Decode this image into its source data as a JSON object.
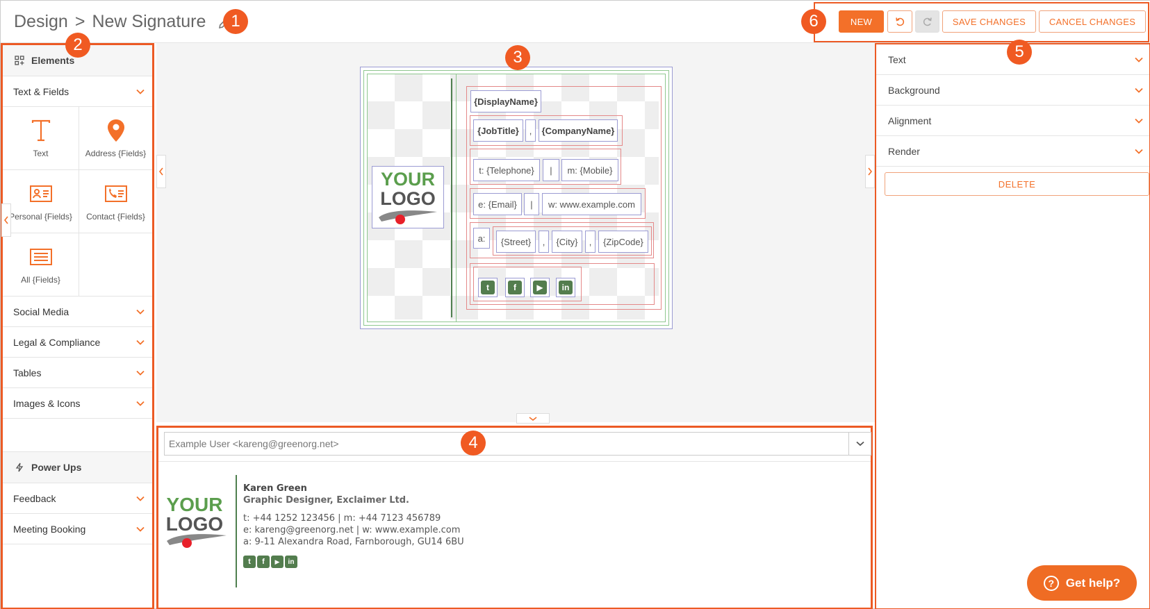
{
  "header": {
    "breadcrumb_parent": "Design",
    "breadcrumb_sep": ">",
    "title": "New Signature"
  },
  "callouts": [
    "1",
    "2",
    "3",
    "4",
    "5",
    "6"
  ],
  "toolbar": {
    "new_label": "NEW",
    "save_label": "SAVE CHANGES",
    "cancel_label": "CANCEL CHANGES"
  },
  "left_panel": {
    "elements_heading": "Elements",
    "text_fields_label": "Text & Fields",
    "tiles": [
      {
        "label": "Text",
        "icon": "text-icon"
      },
      {
        "label": "Address {Fields}",
        "icon": "map-pin-icon"
      },
      {
        "label": "Personal {Fields}",
        "icon": "id-card-icon"
      },
      {
        "label": "Contact {Fields}",
        "icon": "contact-card-icon"
      },
      {
        "label": "All {Fields}",
        "icon": "list-box-icon"
      }
    ],
    "categories": [
      "Social Media",
      "Legal & Compliance",
      "Tables",
      "Images & Icons"
    ],
    "powerups_heading": "Power Ups",
    "powerups": [
      "Feedback",
      "Meeting Booking"
    ]
  },
  "canvas": {
    "logo_line1": "YOUR",
    "logo_line2": "LOGO",
    "display_name": "{DisplayName}",
    "job_title": "{JobTitle}",
    "comma": ",",
    "company_name": "{CompanyName}",
    "telephone": "t: {Telephone}",
    "pipe": "|",
    "mobile": "m: {Mobile}",
    "email": "e: {Email}",
    "website": "w: www.example.com",
    "address_label": "a:",
    "street": "{Street}",
    "city": "{City}",
    "zip": "{ZipCode}"
  },
  "preview": {
    "selected_user": "Example User <kareng@greenorg.net>",
    "logo_line1": "YOUR",
    "logo_line2": "LOGO",
    "name": "Karen Green",
    "job": "Graphic Designer, Exclaimer Ltd.",
    "phones": "t: +44 1252 123456 | m: +44 7123 456789",
    "web": "e: kareng@greenorg.net | w: www.example.com",
    "address": "a: 9-11 Alexandra Road, Farnborough, GU14 6BU"
  },
  "right_panel": {
    "sections": [
      "Text",
      "Background",
      "Alignment",
      "Render"
    ],
    "delete_label": "DELETE"
  },
  "help": {
    "label": "Get help?"
  },
  "colors": {
    "accent": "#f37029",
    "callout": "#f05a22",
    "logo_green": "#5b9e4d",
    "social_green": "#537d4e"
  }
}
